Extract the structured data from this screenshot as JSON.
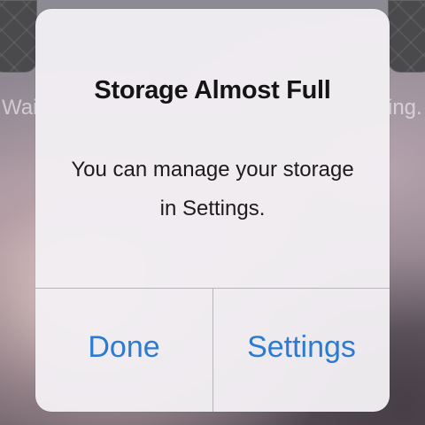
{
  "home_screen": {
    "left_label": "Wait",
    "right_label": "ing..."
  },
  "alert": {
    "title": "Storage Almost Full",
    "message": "You can manage your storage in Settings.",
    "buttons": {
      "done": "Done",
      "settings": "Settings"
    },
    "accent_color": "#2b7ad3"
  }
}
